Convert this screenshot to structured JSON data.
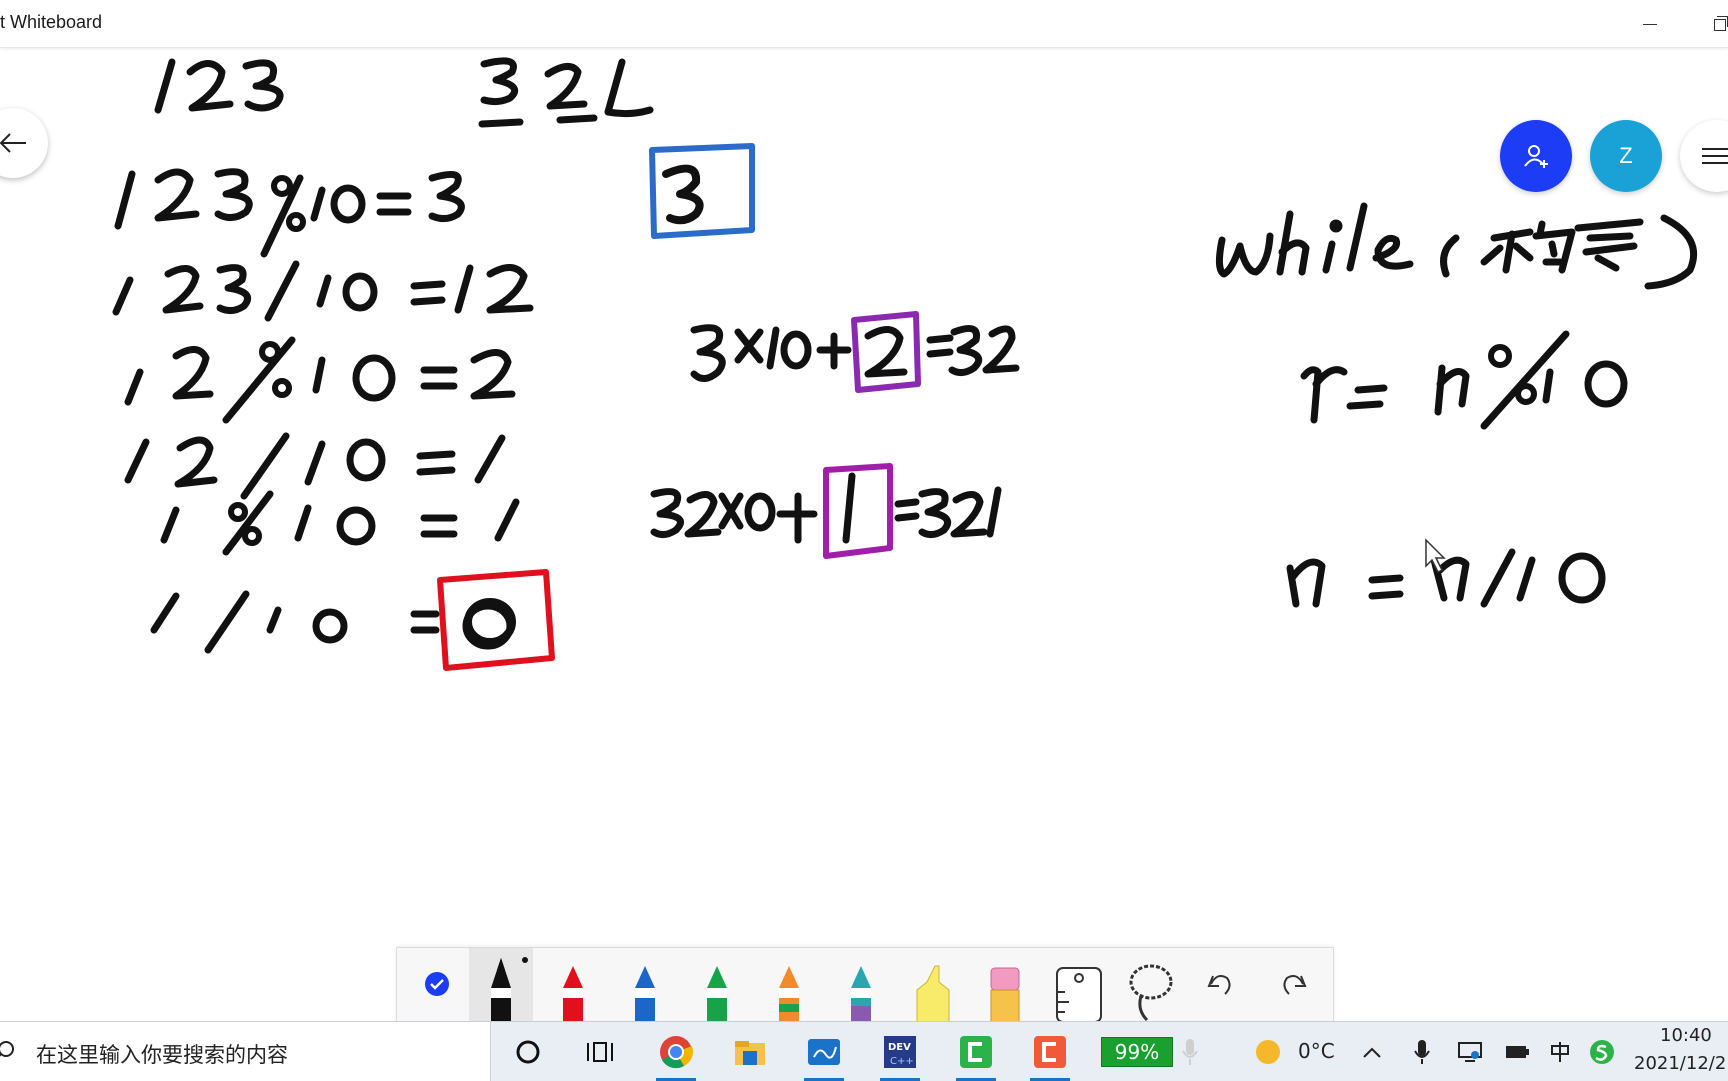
{
  "window": {
    "title": "t Whiteboard"
  },
  "canvas": {
    "left_work": [
      "123",
      "123%10=3",
      "123/10=12",
      "12%10=2",
      "12/10=1",
      "1%10=1",
      "1/10=0"
    ],
    "reverse_number": "321",
    "middle_work": [
      "3",
      "3×10+2=32",
      "32×10+1=321"
    ],
    "right_work": [
      "while(不为零)",
      "r=n%10",
      "n=n/10"
    ]
  },
  "floating": {
    "user_initial": "Z"
  },
  "pen_toolbar": {
    "tools": [
      "select-tool",
      "black-pen",
      "red-pen",
      "blue-pen",
      "green-pen",
      "rainbow-pen",
      "galaxy-pen",
      "highlighter",
      "eraser",
      "ruler",
      "lasso",
      "undo",
      "redo"
    ]
  },
  "taskbar": {
    "search_placeholder": "在这里输入你要搜索的内容",
    "battery_percent": "99%",
    "temperature": "0°C",
    "time": "10:40",
    "date": "2021/12/2"
  },
  "colors": {
    "invite_button": "#1c3cf5",
    "user_button": "#1aa1d6",
    "red_box": "#e0101e",
    "blue_box": "#2a6cc7",
    "purple_box": "#8a2ab0",
    "battery": "#19a02e"
  }
}
